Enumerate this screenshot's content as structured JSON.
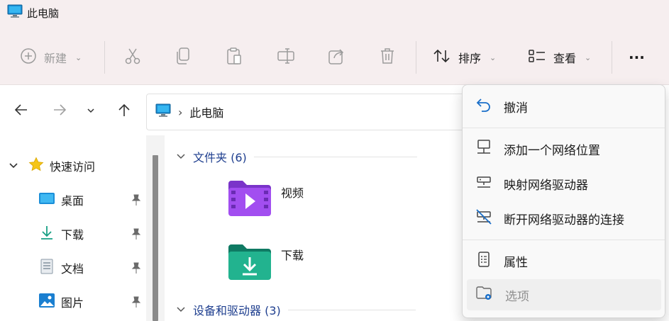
{
  "window": {
    "title": "此电脑",
    "icon": "monitor-icon"
  },
  "toolbar": {
    "new_label": "新建",
    "sort_label": "排序",
    "view_label": "查看",
    "more_label": "···"
  },
  "nav": {
    "address_segments": [
      "此电脑"
    ]
  },
  "sidebar": {
    "quick_access": "快速访问",
    "items": [
      {
        "label": "桌面",
        "icon": "desktop-icon"
      },
      {
        "label": "下载",
        "icon": "download-icon"
      },
      {
        "label": "文档",
        "icon": "document-icon"
      },
      {
        "label": "图片",
        "icon": "pictures-icon"
      }
    ]
  },
  "main": {
    "folders_header": "文件夹 (6)",
    "devices_header": "设备和驱动器 (3)",
    "folders": [
      {
        "label": "视频",
        "icon": "videos-folder-icon"
      },
      {
        "label": "下载",
        "icon": "downloads-folder-icon"
      }
    ]
  },
  "menu": {
    "items": [
      {
        "label": "撤消",
        "icon": "undo-icon"
      },
      {
        "label": "添加一个网络位置",
        "icon": "network-location-icon"
      },
      {
        "label": "映射网络驱动器",
        "icon": "map-drive-icon"
      },
      {
        "label": "断开网络驱动器的连接",
        "icon": "disconnect-drive-icon"
      },
      {
        "label": "属性",
        "icon": "properties-icon"
      },
      {
        "label": "选项",
        "icon": "options-icon"
      }
    ]
  },
  "colors": {
    "accent": "#1f3f8f",
    "titlebar_bg": "#f6eeef",
    "folder_purple": "#8b3fd6",
    "folder_teal": "#1aa88a"
  }
}
